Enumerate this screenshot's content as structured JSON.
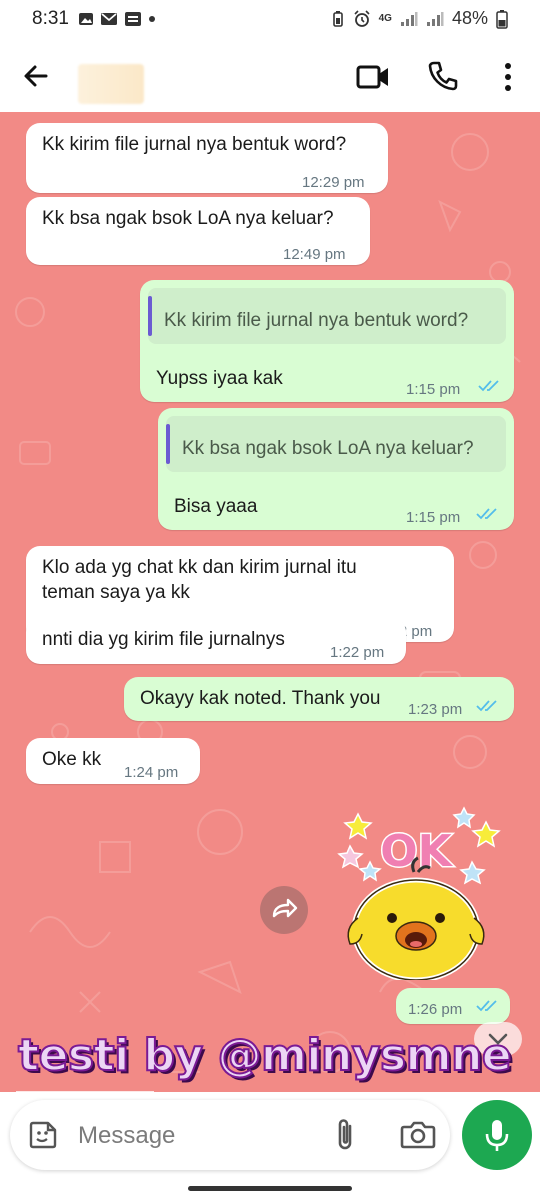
{
  "status_bar": {
    "time": "8:31",
    "battery": "48%",
    "network_badge": "4G"
  },
  "header": {
    "contact_name": ""
  },
  "messages": [
    {
      "id": "m1",
      "direction": "incoming",
      "text": "Kk kirim file jurnal nya bentuk word?",
      "time": "12:29 pm"
    },
    {
      "id": "m2",
      "direction": "incoming",
      "text": "Kk bsa ngak bsok LoA nya keluar?",
      "time": "12:49 pm"
    },
    {
      "id": "m3",
      "direction": "outgoing",
      "quote": "Kk kirim file jurnal nya bentuk word?",
      "text": "Yupss iyaa kak",
      "time": "1:15 pm",
      "status": "read"
    },
    {
      "id": "m4",
      "direction": "outgoing",
      "quote": "Kk bsa ngak bsok LoA nya keluar?",
      "text": "Bisa yaaa",
      "time": "1:15 pm",
      "status": "read"
    },
    {
      "id": "m5",
      "direction": "incoming",
      "text": "Klo ada yg chat kk dan kirim jurnal itu\nteman saya ya kk",
      "time": "1:22 pm"
    },
    {
      "id": "m6",
      "direction": "incoming",
      "text": "nnti dia yg kirim file jurnalnys",
      "time": "1:22 pm"
    },
    {
      "id": "m7",
      "direction": "outgoing",
      "text": "Okayy kak noted. Thank you",
      "time": "1:23 pm",
      "status": "read"
    },
    {
      "id": "m8",
      "direction": "incoming",
      "text": "Oke kk",
      "time": "1:24 pm"
    },
    {
      "id": "m9",
      "direction": "outgoing",
      "type": "sticker",
      "sticker_text": "OK",
      "time": "1:26 pm",
      "status": "read"
    }
  ],
  "watermark": "testi by @minysmne",
  "composer": {
    "placeholder": "Message"
  },
  "colors": {
    "chat_background": "#f28a86",
    "incoming_bubble": "#ffffff",
    "outgoing_bubble": "#d9fdd3",
    "read_ticks": "#53bdeb",
    "mic_button": "#1da851"
  }
}
